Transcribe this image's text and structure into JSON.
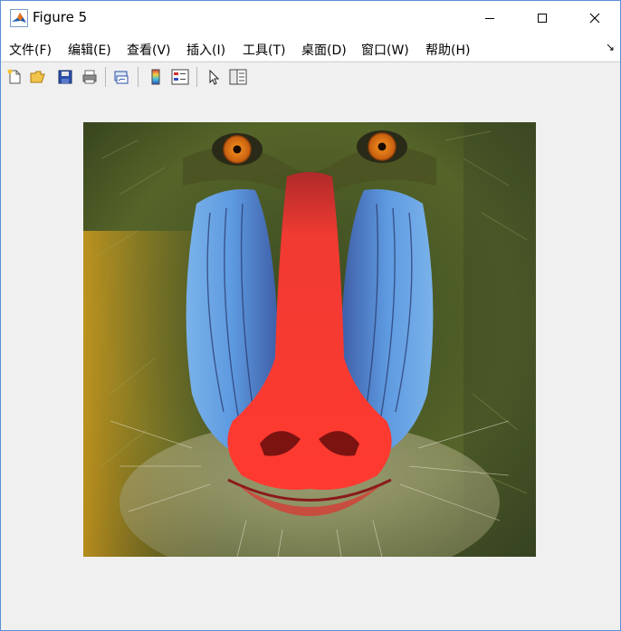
{
  "window": {
    "title": "Figure 5",
    "controls": {
      "minimize_icon": "minimize-icon",
      "maximize_icon": "maximize-icon",
      "close_icon": "close-icon"
    }
  },
  "menubar": {
    "items": [
      {
        "label": "文件(F)"
      },
      {
        "label": "编辑(E)"
      },
      {
        "label": "查看(V)"
      },
      {
        "label": "插入(I)"
      },
      {
        "label": "工具(T)"
      },
      {
        "label": "桌面(D)"
      },
      {
        "label": "窗口(W)"
      },
      {
        "label": "帮助(H)"
      }
    ],
    "overflow_glyph": "↘"
  },
  "toolbar": {
    "tools": [
      "new-figure-icon",
      "open-file-icon",
      "save-icon",
      "print-icon",
      "link-plot-icon",
      "colorbar-icon",
      "legend-icon",
      "edit-plot-cursor-icon",
      "property-editor-icon"
    ]
  },
  "figure": {
    "content": "mandrill-image",
    "colors": {
      "nose_red": "#f0302c",
      "cheek_blue": "#6ea8e8",
      "fur_green": "#5a6a30",
      "fur_yellow": "#c8a020",
      "eye_orange": "#e07818"
    }
  }
}
